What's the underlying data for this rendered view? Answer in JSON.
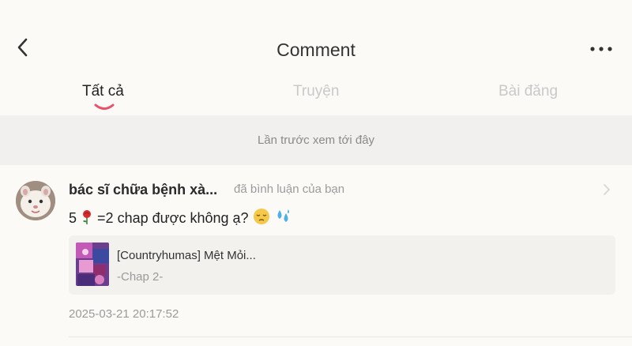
{
  "header": {
    "title": "Comment",
    "back_icon": "chevron-left-icon",
    "more_icon": "more-horizontal-icon"
  },
  "tabs": [
    {
      "label": "Tất cả",
      "active": true
    },
    {
      "label": "Truyện",
      "active": false
    },
    {
      "label": "Bài đăng",
      "active": false
    }
  ],
  "accent_color": "#e8536b",
  "last_seen_text": "Lần trước xem tới đây",
  "comment_item": {
    "username": "bác sĩ chữa bệnh xà...",
    "action": "đã bình luận của bạn",
    "text_before": "5",
    "text_after": "=2 chap được không ạ?",
    "emojis": [
      "rose",
      "pensive-face",
      "sweat-droplets"
    ],
    "card": {
      "title": "[Countryhumas] Mệt Mỏi...",
      "subtitle": "-Chap 2-"
    },
    "timestamp": "2025-03-21 20:17:52"
  }
}
